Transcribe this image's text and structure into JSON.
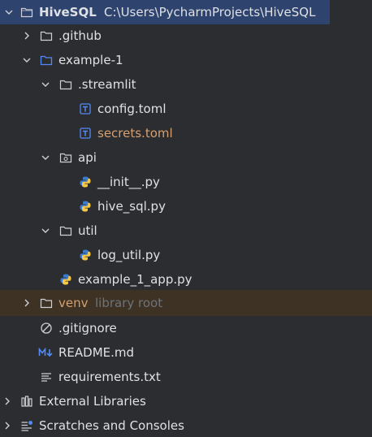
{
  "colors": {
    "background": "#2b2d30",
    "selection": "#2e436e",
    "excluded": "#3d3223",
    "text": "#dfe1e5",
    "modified_text": "#d5a070",
    "hint_text": "#6f737a",
    "folder_blue": "#548af7"
  },
  "project": {
    "name": "HiveSQL",
    "path": "C:\\Users\\PycharmProjects\\HiveSQL"
  },
  "tree": {
    "github": ".github",
    "example1": "example-1",
    "streamlit": ".streamlit",
    "config": "config.toml",
    "secrets": "secrets.toml",
    "api": "api",
    "init": "__init__.py",
    "hive_sql": "hive_sql.py",
    "util": "util",
    "log_util": "log_util.py",
    "app": "example_1_app.py",
    "venv": "venv",
    "venv_hint": "library root",
    "gitignore": ".gitignore",
    "readme": "README.md",
    "requirements": "requirements.txt",
    "external_libraries": "External Libraries",
    "scratches": "Scratches and Consoles"
  }
}
